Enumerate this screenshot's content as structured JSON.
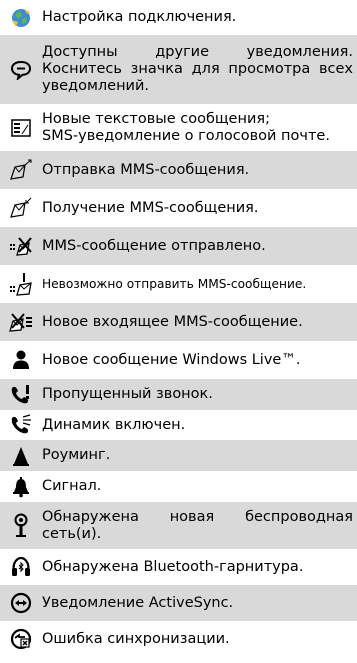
{
  "rows": [
    {
      "icon": "connection-settings-icon",
      "lines": [
        "Настройка подключения."
      ]
    },
    {
      "icon": "speech-bubble-icon",
      "lines": [
        "Доступны другие уведомления. Коснитесь значка для просмотра всех уведомлений."
      ]
    },
    {
      "icon": "sms-icon",
      "lines": [
        "Новые текстовые сообщения;",
        "SMS-уведомление о голосовой почте."
      ]
    },
    {
      "icon": "mms-sending-icon",
      "lines": [
        "Отправка MMS-сообщения."
      ]
    },
    {
      "icon": "mms-receiving-icon",
      "lines": [
        "Получение MMS-сообщения."
      ]
    },
    {
      "icon": "mms-sent-icon",
      "lines": [
        "MMS-сообщение отправлено."
      ]
    },
    {
      "icon": "mms-send-failed-icon",
      "lines": [
        "Невозможно отправить MMS-сообщение."
      ]
    },
    {
      "icon": "mms-incoming-icon",
      "lines": [
        "Новое входящее MMS-сообщение."
      ]
    },
    {
      "icon": "windows-live-person-icon",
      "lines": [
        "Новое сообщение Windows Live™."
      ]
    },
    {
      "icon": "missed-call-icon",
      "lines": [
        "Пропущенный звонок."
      ]
    },
    {
      "icon": "speakerphone-icon",
      "lines": [
        "Динамик включен."
      ]
    },
    {
      "icon": "roaming-icon",
      "lines": [
        "Роуминг."
      ]
    },
    {
      "icon": "alarm-bell-icon",
      "lines": [
        "Сигнал."
      ]
    },
    {
      "icon": "wireless-network-icon",
      "lines": [
        "Обнаружена новая беспроводная сеть(и)."
      ]
    },
    {
      "icon": "bluetooth-headset-icon",
      "lines": [
        "Обнаружена Bluetooth-гарнитура."
      ]
    },
    {
      "icon": "activesync-icon",
      "lines": [
        "Уведомление ActiveSync."
      ]
    },
    {
      "icon": "sync-error-icon",
      "lines": [
        "Ошибка синхронизации."
      ]
    }
  ]
}
